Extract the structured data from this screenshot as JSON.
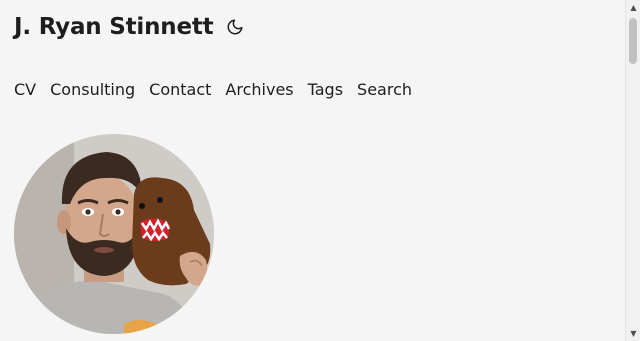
{
  "header": {
    "title": "J. Ryan Stinnett",
    "theme_icon": "moon-icon"
  },
  "nav": {
    "items": [
      "CV",
      "Consulting",
      "Contact",
      "Archives",
      "Tags",
      "Search"
    ]
  },
  "profile": {
    "photo": "profile-photo"
  },
  "scrollbar": {
    "up_glyph": "▲",
    "down_glyph": "▼"
  },
  "colors": {
    "background": "#f5f5f5",
    "text": "#1e1e1e"
  }
}
